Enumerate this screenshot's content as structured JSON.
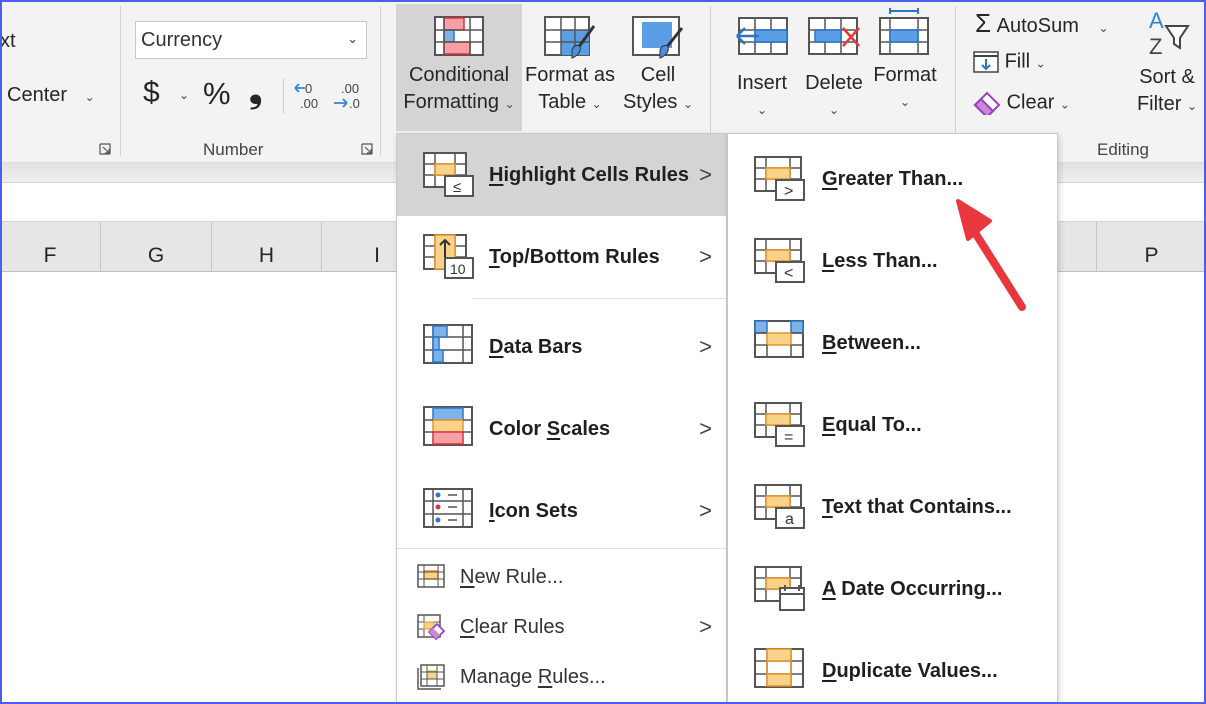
{
  "ribbon": {
    "alignment_partial": {
      "wrap_text_fragment": "xt",
      "merge_center_label": "Center"
    },
    "number_group": {
      "label": "Number",
      "format_value": "Currency",
      "currency_symbol": "$",
      "percent_symbol": "%",
      "comma_symbol": "❟",
      "increase_decimal": "←0 .00",
      "decrease_decimal": ".00 →0"
    },
    "styles_group": {
      "conditional_formatting": [
        "Conditional",
        "Formatting"
      ],
      "format_as_table": [
        "Format as",
        "Table"
      ],
      "cell_styles": [
        "Cell",
        "Styles"
      ]
    },
    "cells_group": {
      "insert": "Insert",
      "delete": "Delete",
      "format": "Format"
    },
    "editing_group": {
      "label": "Editing",
      "autosum": "AutoSum",
      "autosum_symbol": "Σ",
      "fill": "Fill",
      "clear": "Clear",
      "sort_filter": [
        "Sort &",
        "Filter"
      ]
    }
  },
  "columns": [
    "F",
    "G",
    "H",
    "I",
    "P"
  ],
  "conditional_formatting_menu": {
    "items": [
      {
        "pre": "",
        "accel": "H",
        "post": "ighlight Cells Rules",
        "icon": "highlight-cells-icon",
        "submenu": true,
        "highlighted": true
      },
      {
        "pre": "",
        "accel": "T",
        "post": "op/Bottom Rules",
        "icon": "top-bottom-icon",
        "submenu": true
      },
      {
        "pre": "",
        "accel": "D",
        "post": "ata Bars",
        "icon": "data-bars-icon",
        "submenu": true
      },
      {
        "pre": "Color ",
        "accel": "S",
        "post": "cales",
        "icon": "color-scales-icon",
        "submenu": true
      },
      {
        "pre": "",
        "accel": "I",
        "post": "con Sets",
        "icon": "icon-sets-icon",
        "submenu": true
      }
    ],
    "small_items": [
      {
        "pre": "",
        "accel": "N",
        "post": "ew Rule...",
        "icon": "new-rule-icon",
        "submenu": false
      },
      {
        "pre": "",
        "accel": "C",
        "post": "lear Rules",
        "icon": "clear-rules-icon",
        "submenu": true
      },
      {
        "pre": "Manage ",
        "accel": "R",
        "post": "ules...",
        "icon": "manage-rules-icon",
        "submenu": false
      }
    ],
    "submenu_arrow": ">"
  },
  "highlight_cells_submenu": {
    "items": [
      {
        "pre": "",
        "accel": "G",
        "post": "reater Than...",
        "badge": ">"
      },
      {
        "pre": "",
        "accel": "L",
        "post": "ess Than...",
        "badge": "<"
      },
      {
        "pre": "",
        "accel": "B",
        "post": "etween...",
        "badge": ""
      },
      {
        "pre": "",
        "accel": "E",
        "post": "qual To...",
        "badge": "="
      },
      {
        "pre": "",
        "accel": "T",
        "post": "ext that Contains...",
        "badge": "a"
      },
      {
        "pre": "",
        "accel": "A",
        "post": " Date Occurring...",
        "badge": "cal"
      },
      {
        "pre": "",
        "accel": "D",
        "post": "uplicate Values...",
        "badge": ""
      }
    ]
  },
  "annotation": {
    "arrow_color": "#e8383d",
    "points_to": "Greater Than..."
  }
}
